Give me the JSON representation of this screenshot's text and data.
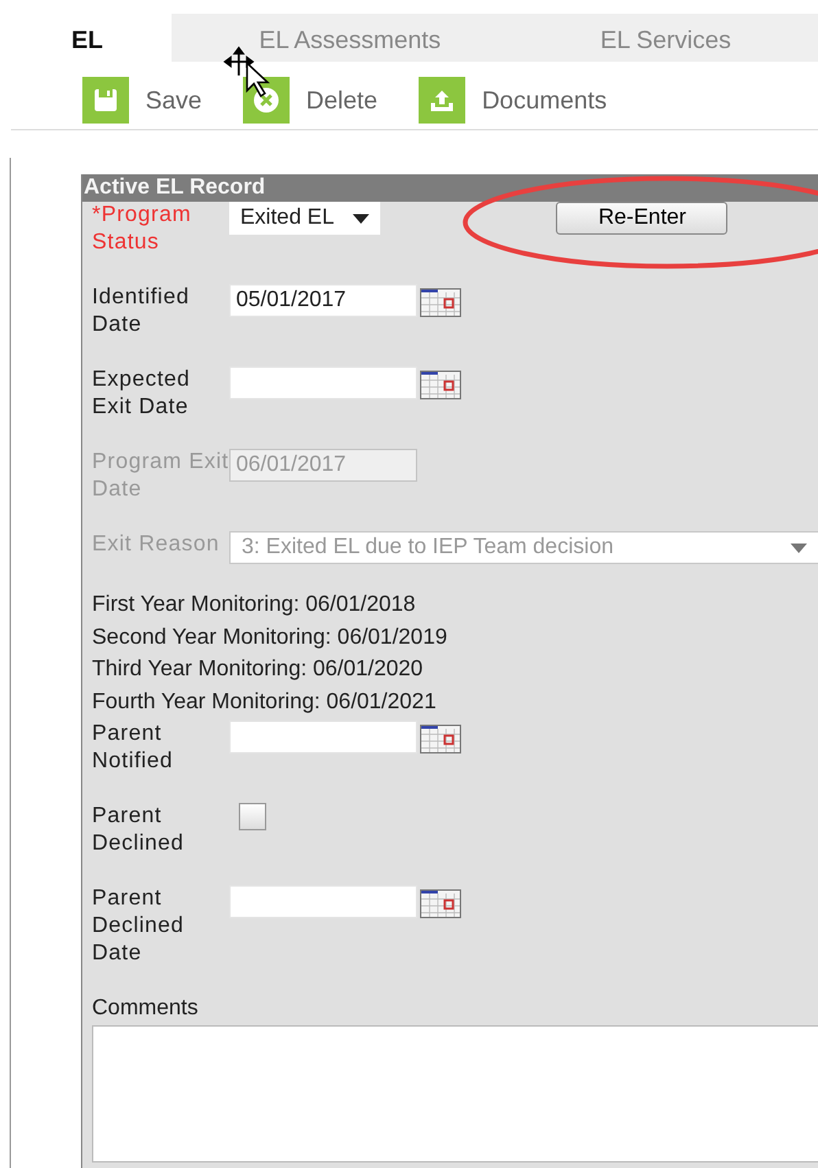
{
  "tabs": [
    {
      "label": "EL",
      "selected": true
    },
    {
      "label": "EL Assessments",
      "selected": false
    },
    {
      "label": "EL Services",
      "selected": false
    }
  ],
  "toolbar": [
    {
      "label": "Save",
      "kind": "save"
    },
    {
      "label": "Delete",
      "kind": "delete"
    },
    {
      "label": "Documents",
      "kind": "upload"
    }
  ],
  "panel": {
    "title": "Active EL Record",
    "reenter_button": "Re-Enter",
    "fields": [
      {
        "kind": "select",
        "label": "*Program Status",
        "required": true,
        "disabled": false,
        "value": "Exited EL"
      },
      {
        "kind": "date",
        "label": "Identified Date",
        "disabled": false,
        "value": "05/01/2017"
      },
      {
        "kind": "date",
        "label": "Expected Exit Date",
        "disabled": false
      },
      {
        "kind": "date",
        "label": "Program Exit Date",
        "disabled": true,
        "value": "06/01/2017"
      },
      {
        "kind": "select",
        "label": "Exit Reason",
        "required": false,
        "disabled": true,
        "value": "3: Exited EL due to IEP Team decision"
      },
      {
        "kind": "info",
        "text": "First Year Monitoring: 06/01/2018"
      },
      {
        "kind": "info",
        "text": "Second Year Monitoring: 06/01/2019"
      },
      {
        "kind": "info",
        "text": "Third Year Monitoring: 06/01/2020"
      },
      {
        "kind": "info",
        "text": "Fourth Year Monitoring: 06/01/2021"
      },
      {
        "kind": "date",
        "label": "Parent Notified",
        "disabled": false
      },
      {
        "kind": "checkbox",
        "label": "Parent Declined",
        "checked": false
      },
      {
        "kind": "date",
        "label": "Parent Declined Date",
        "disabled": false
      },
      {
        "kind": "textarea",
        "label": "Comments"
      }
    ]
  },
  "annotations": [
    {
      "kind": "ellipse",
      "color": "#e8403f"
    }
  ]
}
